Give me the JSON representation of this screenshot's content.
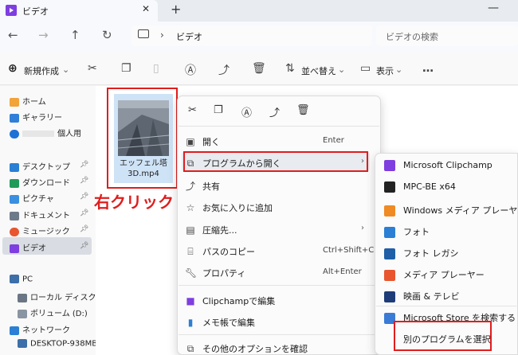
{
  "window": {
    "tab_title": "ビデオ",
    "tab_close": "✕",
    "new_tab": "+",
    "minimize": "—"
  },
  "nav": {
    "address": "ビデオ",
    "search_placeholder": "ビデオの検索",
    "separator": "›"
  },
  "toolbar": {
    "new_label": "新規作成",
    "sort_label": "並べ替え",
    "view_label": "表示",
    "more": "…"
  },
  "sidebar": {
    "items": [
      {
        "label": "ホーム"
      },
      {
        "label": "ギャラリー"
      },
      {
        "label": "個人用"
      },
      {
        "label": "デスクトップ"
      },
      {
        "label": "ダウンロード"
      },
      {
        "label": "ピクチャ"
      },
      {
        "label": "ドキュメント"
      },
      {
        "label": "ミュージック"
      },
      {
        "label": "ビデオ"
      },
      {
        "label": "PC"
      },
      {
        "label": "ローカル ディスク (C:"
      },
      {
        "label": "ボリューム (D:)"
      },
      {
        "label": "ネットワーク"
      },
      {
        "label": "DESKTOP-938MB"
      }
    ]
  },
  "file": {
    "name_line1": "エッフェル塔",
    "name_line2": "3D.mp4"
  },
  "annotation": {
    "right_click": "右クリック"
  },
  "context_menu": {
    "items": [
      {
        "label": "開く",
        "accel": "Enter"
      },
      {
        "label": "プログラムから開く",
        "arrow": "›"
      },
      {
        "label": "共有"
      },
      {
        "label": "お気に入りに追加"
      },
      {
        "label": "圧縮先...",
        "arrow": "›"
      },
      {
        "label": "パスのコピー",
        "accel": "Ctrl+Shift+C"
      },
      {
        "label": "プロパティ",
        "accel": "Alt+Enter"
      },
      {
        "label": "Clipchampで編集"
      },
      {
        "label": "メモ帳で編集"
      },
      {
        "label": "その他のオプションを確認"
      }
    ]
  },
  "submenu": {
    "items": [
      {
        "label": "Microsoft Clipchamp"
      },
      {
        "label": "MPC-BE x64"
      },
      {
        "label": "Windows メディア プレーヤー従"
      },
      {
        "label": "フォト"
      },
      {
        "label": "フォト レガシ"
      },
      {
        "label": "メディア プレーヤー"
      },
      {
        "label": "映画 & テレビ"
      },
      {
        "label": "Microsoft Store を検索する"
      },
      {
        "label": "別のプログラムを選択"
      }
    ]
  },
  "colors": {
    "highlight_red": "#e01d1d",
    "accent_purple": "#7e3ee0"
  }
}
